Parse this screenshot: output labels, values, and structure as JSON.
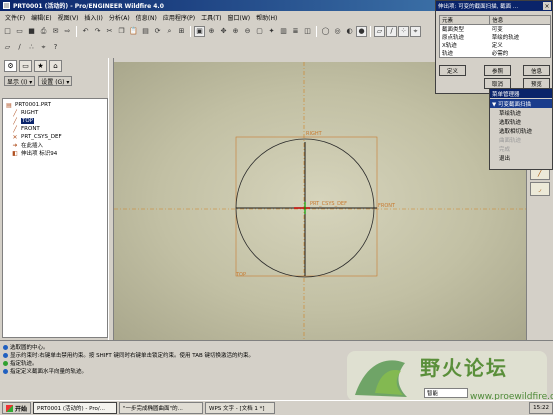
{
  "window": {
    "title": "PRT0001 (活动的) - Pro/ENGINEER Wildfire 4.0"
  },
  "menu": [
    "文件(F)",
    "编辑(E)",
    "视图(V)",
    "插入(I)",
    "分析(A)",
    "信息(N)",
    "应用程序(P)",
    "工具(T)",
    "窗口(W)",
    "帮助(H)"
  ],
  "left_panel": {
    "show_label": "显示 (I) ▾",
    "settings_label": "设置 (G) ▾",
    "tree": [
      {
        "icon": "part-icon",
        "label": "PRT0001.PRT",
        "selected": false
      },
      {
        "icon": "datum-plane-icon",
        "label": "RIGHT",
        "selected": false
      },
      {
        "icon": "datum-plane-icon",
        "label": "TOP",
        "selected": true
      },
      {
        "icon": "datum-plane-icon",
        "label": "FRONT",
        "selected": false
      },
      {
        "icon": "csys-icon",
        "label": "PRT_CSYS_DEF",
        "selected": false
      },
      {
        "icon": "insert-here-icon",
        "label": "在此插入",
        "selected": false
      },
      {
        "icon": "feature-icon",
        "label": "伸出项 标识94",
        "selected": false
      }
    ]
  },
  "canvas": {
    "labels": {
      "right": "RIGHT",
      "top": "TOP",
      "front": "FRONT",
      "csys": "PRT_CSYS_DEF"
    }
  },
  "profile_dialog": {
    "title": "伸出项: 可变的截面扫描, 截面 ...",
    "columns": [
      "元素",
      "信息"
    ],
    "rows": [
      {
        "element": "截面类型",
        "info": "可变"
      },
      {
        "element": "原点轨迹",
        "info": "草绘的轨迹"
      },
      {
        "element": "X轨迹",
        "info": "定义"
      },
      {
        "element": "轨迹",
        "info": "必需的"
      }
    ],
    "buttons": {
      "define": "定义",
      "reference": "参照",
      "info": "信息",
      "cancel": "取消",
      "preview": "预览"
    }
  },
  "menu_manager": {
    "title": "菜单管理器",
    "header": "▼ 可变截面扫描",
    "items": [
      {
        "label": "草绘轨迹",
        "enabled": true
      },
      {
        "label": "选取轨迹",
        "enabled": true
      },
      {
        "label": "选取相切轨迹",
        "enabled": true
      },
      {
        "label": "曲面轨迹",
        "enabled": false
      },
      {
        "label": "完成",
        "enabled": false
      },
      {
        "label": "退出",
        "enabled": true
      }
    ]
  },
  "messages": [
    {
      "icon": "info",
      "text": "选取圆的中心。"
    },
    {
      "icon": "info",
      "text": "显示约束时:右键单击禁用约束。按 SHIFT 键同时右键单击锁定约束。使用 TAB 键切换激活的约束。"
    },
    {
      "icon": "ok",
      "text": "指定轨迹。"
    },
    {
      "icon": "info",
      "text": "指定定义截面水平向量的轨迹。"
    }
  ],
  "status_box": "智能",
  "watermark": {
    "text": "野火论坛",
    "sub": "www.proewildfire.cn"
  },
  "taskbar": {
    "start": "开始",
    "tasks": [
      {
        "label": "PRT0001 (活动的) - Pro/...",
        "active": true
      },
      {
        "label": "\"一步完成椭圆曲面\"的...",
        "active": false
      },
      {
        "label": "WPS 文字 - [文档 1 *]",
        "active": false
      }
    ],
    "clock": "15:22"
  }
}
